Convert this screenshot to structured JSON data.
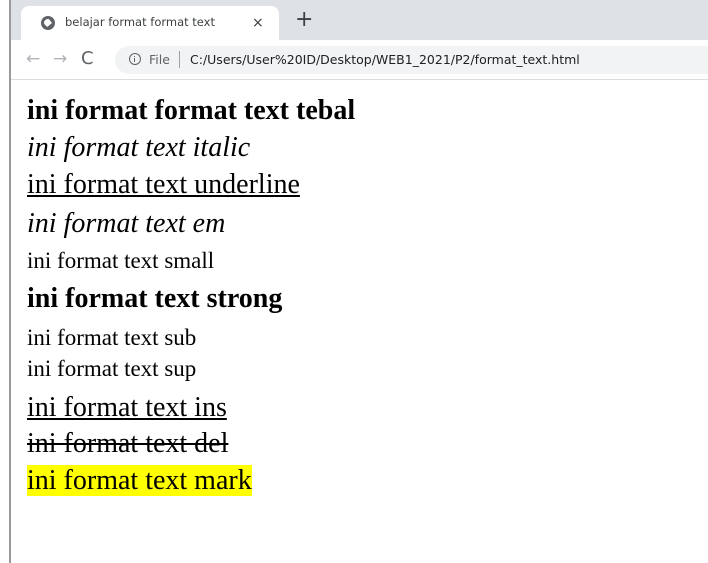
{
  "browser": {
    "tab": {
      "title": "belajar format format text",
      "close_glyph": "×",
      "icon": "globe-icon"
    },
    "new_tab_glyph": "+",
    "nav": {
      "back_glyph": "←",
      "forward_glyph": "→",
      "reload_glyph": "C"
    },
    "omnibox": {
      "scheme_label": "File",
      "url": "C:/Users/User%20ID/Desktop/WEB1_2021/P2/format_text.html",
      "icon": "info-icon"
    }
  },
  "page": {
    "lines": {
      "bold": "ini format format text tebal",
      "italic": "ini format text italic",
      "underline": "ini format text underline",
      "em": "ini format text em",
      "small": "ini format text small",
      "strong": "ini format text strong",
      "sub": "ini format text sub",
      "sup": "ini format text sup",
      "ins": "ini format text ins",
      "del": "ini format text del",
      "mark": "ini format text mark"
    },
    "mark_color": "#ffff00"
  }
}
